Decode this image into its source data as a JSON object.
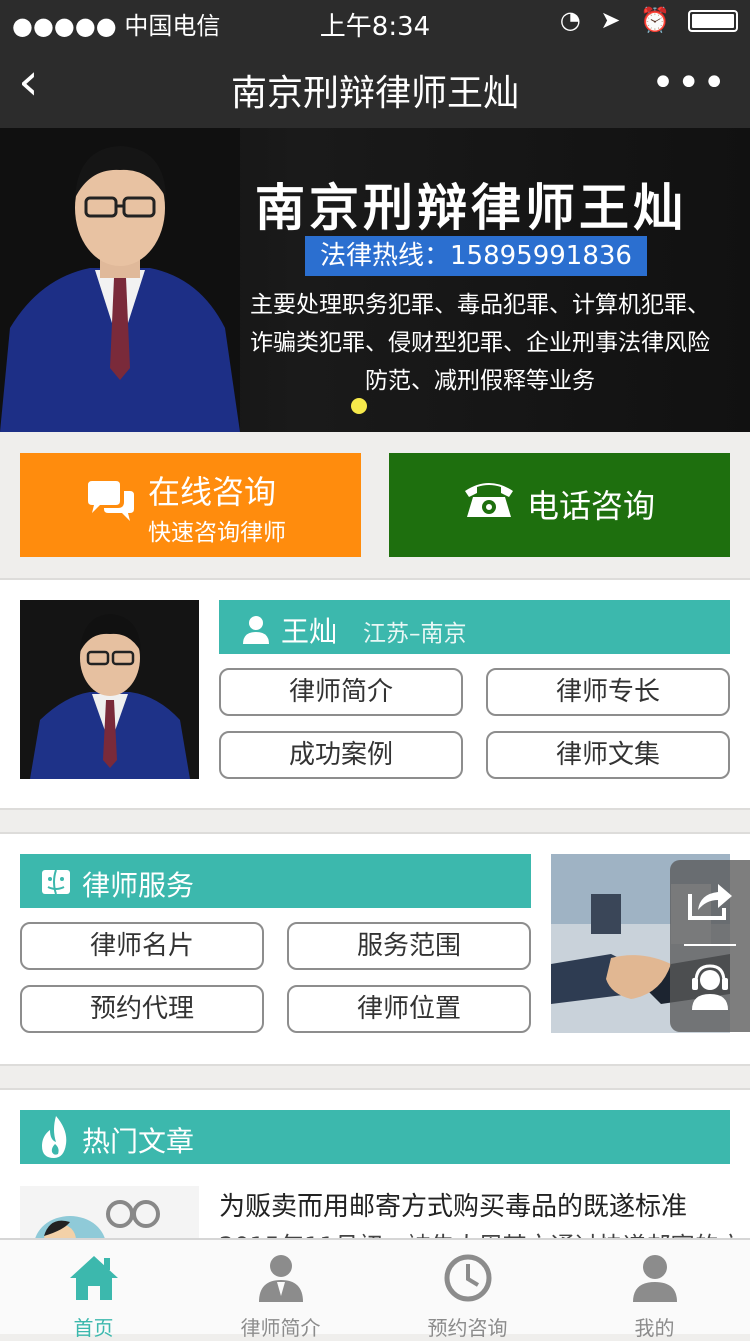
{
  "status_bar": {
    "carrier": "●●●●● 中国电信",
    "time": "上午8:34"
  },
  "nav": {
    "title": "南京刑辩律师王灿"
  },
  "banner": {
    "title": "南京刑辩律师王灿",
    "hotline": "法律热线：15895991836",
    "description_lines": [
      "主要处理职务犯罪、毒品犯罪、计算机犯罪、",
      "诈骗类犯罪、侵财型犯罪、企业刑事法律风险",
      "防范、减刑假释等业务"
    ]
  },
  "consult": {
    "online_title": "在线咨询",
    "online_sub": "快速咨询律师",
    "phone_title": "电话咨询"
  },
  "lawyer": {
    "name": "王灿",
    "region": "江苏–南京",
    "buttons": [
      "律师简介",
      "律师专长",
      "成功案例",
      "律师文集"
    ]
  },
  "service": {
    "label": "律师服务",
    "buttons": [
      "律师名片",
      "服务范围",
      "预约代理",
      "律师位置"
    ]
  },
  "articles": {
    "label": "热门文章",
    "first_title": "为贩卖而用邮寄方式购买毒品的既遂标准",
    "first_summary": "2015年11月初，被告人周某文通过快递邮寄的方"
  },
  "tabs": [
    {
      "label": "首页",
      "icon": "home-icon",
      "active": true
    },
    {
      "label": "律师简介",
      "icon": "person-icon",
      "active": false
    },
    {
      "label": "预约咨询",
      "icon": "clock-icon",
      "active": false
    },
    {
      "label": "我的",
      "icon": "user-icon",
      "active": false
    }
  ],
  "colors": {
    "accent": "#3cb8ad",
    "online": "#ff8c0d",
    "phone": "#1e6f0e",
    "hotline": "#2b6fd0"
  }
}
